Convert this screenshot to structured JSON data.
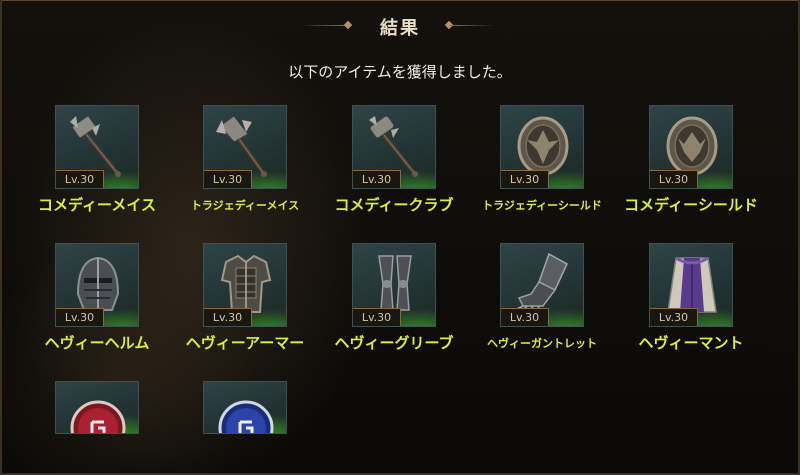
{
  "dialog": {
    "title": "結果",
    "message": "以下のアイテムを獲得しました。"
  },
  "items": [
    {
      "name": "コメディーメイス",
      "level": "Lv.30",
      "icon": "mace-icon"
    },
    {
      "name": "トラジェディーメイス",
      "level": "Lv.30",
      "icon": "mace-icon"
    },
    {
      "name": "コメディークラブ",
      "level": "Lv.30",
      "icon": "club-icon"
    },
    {
      "name": "トラジェディーシールド",
      "level": "Lv.30",
      "icon": "shield-icon"
    },
    {
      "name": "コメディーシールド",
      "level": "Lv.30",
      "icon": "shield-icon"
    },
    {
      "name": "ヘヴィーヘルム",
      "level": "Lv.30",
      "icon": "helm-icon"
    },
    {
      "name": "ヘヴィーアーマー",
      "level": "Lv.30",
      "icon": "armor-icon"
    },
    {
      "name": "ヘヴィーグリーブ",
      "level": "Lv.30",
      "icon": "greaves-icon"
    },
    {
      "name": "ヘヴィーガントレット",
      "level": "Lv.30",
      "icon": "gauntlet-icon"
    },
    {
      "name": "ヘヴィーマント",
      "level": "Lv.30",
      "icon": "mantle-icon"
    },
    {
      "name": "",
      "level": "",
      "icon": "red-rune-orb-icon"
    },
    {
      "name": "",
      "level": "",
      "icon": "blue-rune-orb-icon"
    }
  ],
  "colors": {
    "item_name": "#d7f23a",
    "level_badge_border": "#8b6a38",
    "slot_glow": "#3caa28"
  }
}
